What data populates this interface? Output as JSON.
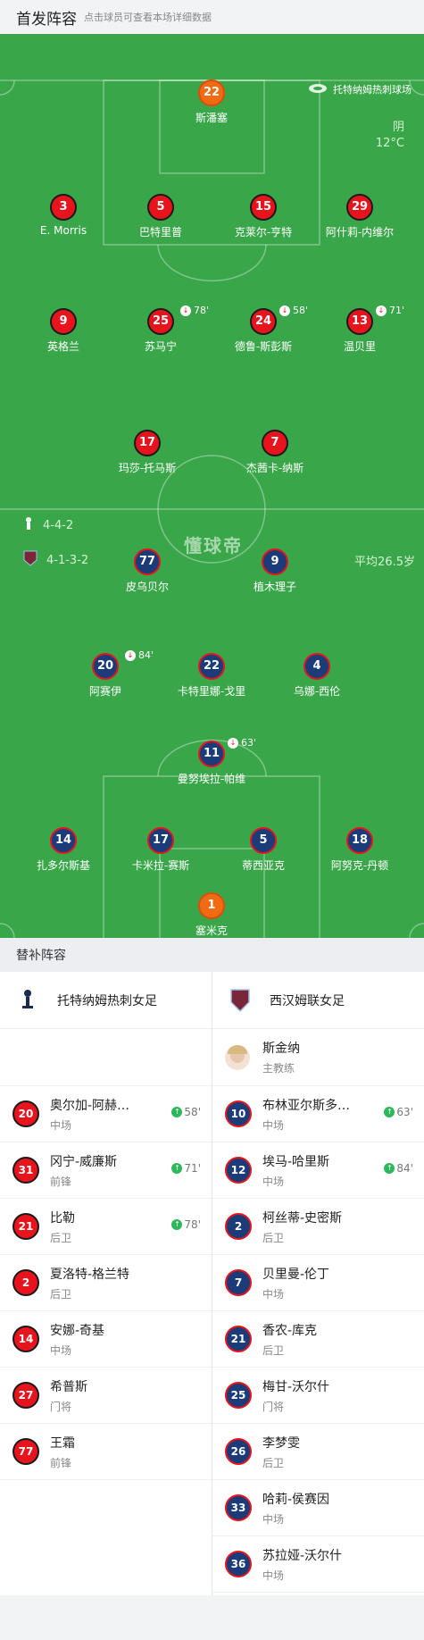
{
  "header": {
    "title": "首发阵容",
    "subtitle": "点击球员可查看本场详细数据"
  },
  "pitch": {
    "stadium": "托特纳姆热刺球场",
    "weather": "阴",
    "temperature": "12°C",
    "home_formation": "4-4-2",
    "away_formation": "4-1-3-2",
    "avg_age": "平均26.5岁",
    "watermark": "懂球帝"
  },
  "home_lineup": [
    {
      "num": "22",
      "name": "斯潘塞",
      "gk": true
    },
    {
      "num": "3",
      "name": "E. Morris"
    },
    {
      "num": "5",
      "name": "巴特里普"
    },
    {
      "num": "15",
      "name": "克莱尔-亨特",
      "yellow": true
    },
    {
      "num": "29",
      "name": "阿什莉-内维尔",
      "yellow": true
    },
    {
      "num": "9",
      "name": "英格兰",
      "captain": "C",
      "goal": true
    },
    {
      "num": "25",
      "name": "苏马宁",
      "yellow": true,
      "sub_min": "78'"
    },
    {
      "num": "24",
      "name": "德鲁-斯彭斯",
      "sub_min": "58'"
    },
    {
      "num": "13",
      "name": "温贝里",
      "sub_min": "71'"
    },
    {
      "num": "17",
      "name": "玛莎-托马斯"
    },
    {
      "num": "7",
      "name": "杰茜卡-纳斯"
    }
  ],
  "away_lineup": [
    {
      "num": "77",
      "name": "皮乌贝尔"
    },
    {
      "num": "9",
      "name": "植木理子",
      "yellow": true,
      "goal": true
    },
    {
      "num": "20",
      "name": "阿赛伊",
      "yellow": true,
      "sub_min": "84'",
      "goal": true
    },
    {
      "num": "22",
      "name": "卡特里娜-戈里",
      "captain": "C"
    },
    {
      "num": "4",
      "name": "乌娜-西伦"
    },
    {
      "num": "11",
      "name": "曼努埃拉-帕维",
      "sub_min": "63'"
    },
    {
      "num": "14",
      "name": "扎多尔斯基"
    },
    {
      "num": "17",
      "name": "卡米拉-赛斯",
      "goal": true
    },
    {
      "num": "5",
      "name": "蒂西亚克"
    },
    {
      "num": "18",
      "name": "阿努克-丹顿"
    },
    {
      "num": "1",
      "name": "塞米克",
      "gk": true
    }
  ],
  "subs": {
    "title": "替补阵容",
    "home_team": "托特纳姆热刺女足",
    "away_team": "西汉姆联女足",
    "away_coach": {
      "name": "斯金纳",
      "role": "主教练"
    },
    "home": [
      {
        "num": "20",
        "name": "奥尔加-阿赫…",
        "pos": "中场",
        "in": "58'"
      },
      {
        "num": "31",
        "name": "冈宁-威廉斯",
        "pos": "前锋",
        "in": "71'"
      },
      {
        "num": "21",
        "name": "比勒",
        "pos": "后卫",
        "in": "78'"
      },
      {
        "num": "2",
        "name": "夏洛特-格兰特",
        "pos": "后卫"
      },
      {
        "num": "14",
        "name": "安娜-奇基",
        "pos": "中场"
      },
      {
        "num": "27",
        "name": "希普斯",
        "pos": "门将"
      },
      {
        "num": "77",
        "name": "王霜",
        "pos": "前锋"
      }
    ],
    "away": [
      {
        "num": "10",
        "name": "布林亚尔斯多…",
        "pos": "中场",
        "in": "63'"
      },
      {
        "num": "12",
        "name": "埃马-哈里斯",
        "pos": "中场",
        "in": "84'"
      },
      {
        "num": "2",
        "name": "柯丝蒂-史密斯",
        "pos": "后卫"
      },
      {
        "num": "7",
        "name": "贝里曼-伦丁",
        "pos": "中场"
      },
      {
        "num": "21",
        "name": "香农-库克",
        "pos": "后卫"
      },
      {
        "num": "25",
        "name": "梅甘-沃尔什",
        "pos": "门将"
      },
      {
        "num": "26",
        "name": "李梦雯",
        "pos": "后卫"
      },
      {
        "num": "33",
        "name": "哈莉-侯赛因",
        "pos": "中场"
      },
      {
        "num": "36",
        "name": "苏拉娅-沃尔什",
        "pos": "中场"
      }
    ]
  },
  "colors": {
    "pitch": "#3aa64a",
    "home": "#e8141d",
    "away": "#1b3c78",
    "gk": "#f06b12",
    "card": "#f5d316",
    "sub_in": "#2eb85c"
  }
}
